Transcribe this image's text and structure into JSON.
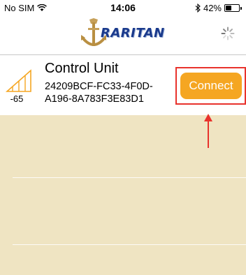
{
  "status_bar": {
    "carrier": "No SIM",
    "time": "14:06",
    "battery": "42%",
    "battery_level": 0.42
  },
  "nav_bar": {
    "logo_text": "RARITAN"
  },
  "device": {
    "name": "Control Unit",
    "uuid": "24209BCF-FC33-4F0D-A196-8A783F3E83D1",
    "rssi": "-65",
    "connect_label": "Connect"
  },
  "colors": {
    "accent": "#f5a622",
    "highlight": "#e8322c",
    "list_background": "#efe4c2",
    "logo": "#1a3a8c"
  },
  "icons": [
    "wifi-icon",
    "bluetooth-icon",
    "battery-icon",
    "raritan-logo",
    "loading-spinner-icon",
    "signal-strength-icon",
    "annotation-arrow"
  ]
}
